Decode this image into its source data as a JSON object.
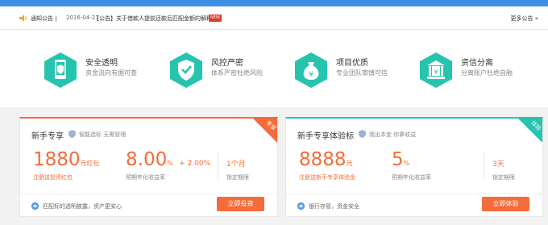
{
  "notice": {
    "label": "通知公告 |",
    "date": "2016-04-27",
    "title": "【公告】关于借款人提前还款后匹配金额的解释",
    "new_badge": "NEW",
    "more": "更多公告 »"
  },
  "features": [
    {
      "title": "安全透明",
      "subtitle": "资金流向有据可查",
      "icon": "phone-shield-icon"
    },
    {
      "title": "风控严密",
      "subtitle": "体系严密杜绝风险",
      "icon": "shield-check-icon"
    },
    {
      "title": "项目优质",
      "subtitle": "专业团队审慎可信",
      "icon": "money-bag-icon"
    },
    {
      "title": "资信分离",
      "subtitle": "分离账户杜绝自融",
      "icon": "bank-icon"
    }
  ],
  "cards": {
    "left": {
      "title": "新手专享",
      "ribbon": "专享",
      "tag": "智能选标 无需管理",
      "amount": "1880",
      "amount_unit": "元红包",
      "amount_sub": "注册送投资红包",
      "rate": "8.00",
      "rate_unit": "%",
      "rate_plus": "+ 2.00%",
      "rate_sub": "预期年化收益率",
      "term": "1个月",
      "term_sub": "锁定期限",
      "foot": "匹配标的透明披露，资产更安心",
      "button": "立即投资"
    },
    "right": {
      "title": "新手专享体验标",
      "ribbon": "体验",
      "tag": "我出本金 你拿收益",
      "amount": "8888",
      "amount_unit": "元",
      "amount_sub": "注册送新手专享体验金",
      "rate": "5",
      "rate_unit": "%",
      "rate_sub": "预期年化收益率",
      "term": "3天",
      "term_sub": "锁定期限",
      "foot": "银行存管，资金安全",
      "button": "立即体验"
    }
  },
  "colors": {
    "accent": "#f56b3a",
    "teal": "#26c4ae",
    "topbar": "#3d8ee0"
  }
}
